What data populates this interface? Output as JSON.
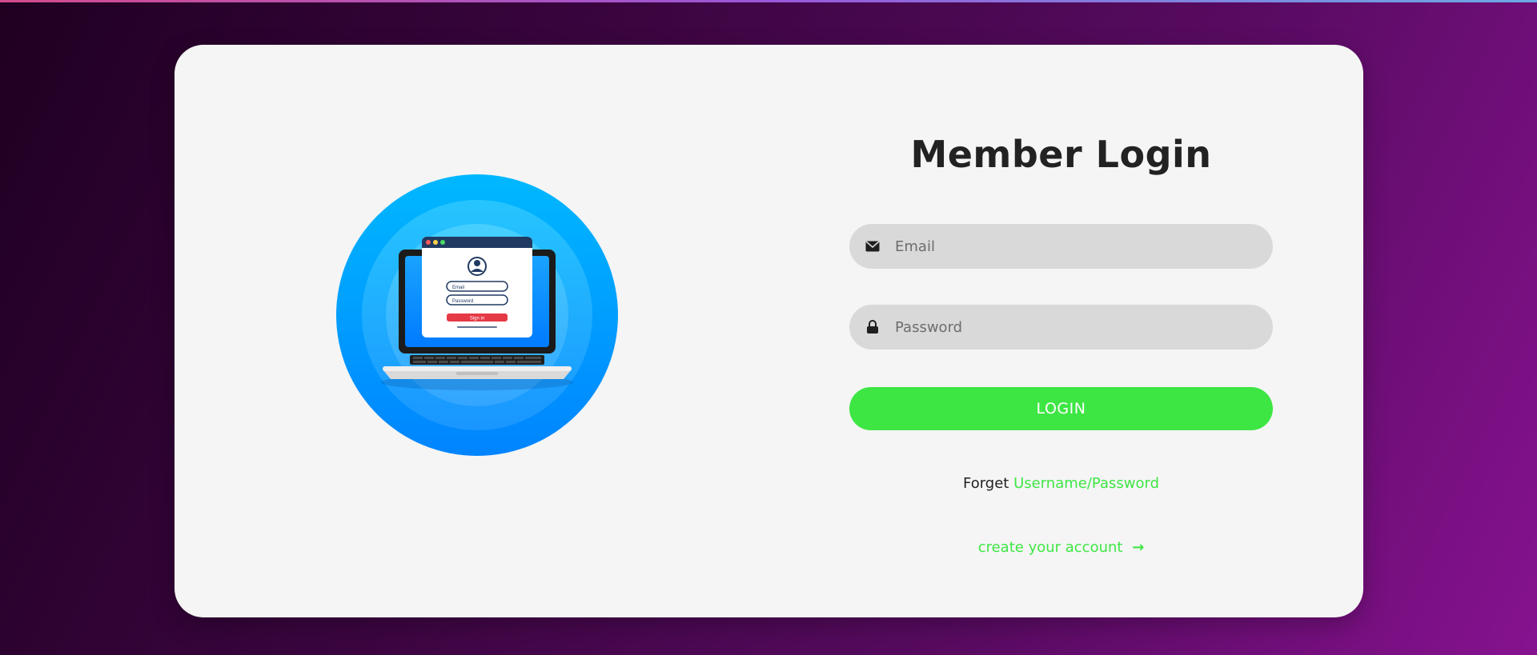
{
  "form": {
    "title": "Member Login",
    "email_placeholder": "Email",
    "password_placeholder": "Password",
    "login_label": "LOGIN",
    "forgot_prefix": "Forget",
    "forgot_link": "Username/Password",
    "create_link": "create your account",
    "create_arrow": "→"
  },
  "illustration": {
    "email_label": "Email",
    "password_label": "Password",
    "signin_label": "Sign in"
  },
  "icons": {
    "email": "envelope-icon",
    "password": "lock-icon",
    "arrow": "arrow-right-icon",
    "illustration": "laptop-login-illustration"
  },
  "colors": {
    "accent": "#3ee644",
    "card": "#f5f5f5",
    "field": "#d9d9d9",
    "title": "#222222",
    "illustration_blue": "#00b4ff"
  }
}
